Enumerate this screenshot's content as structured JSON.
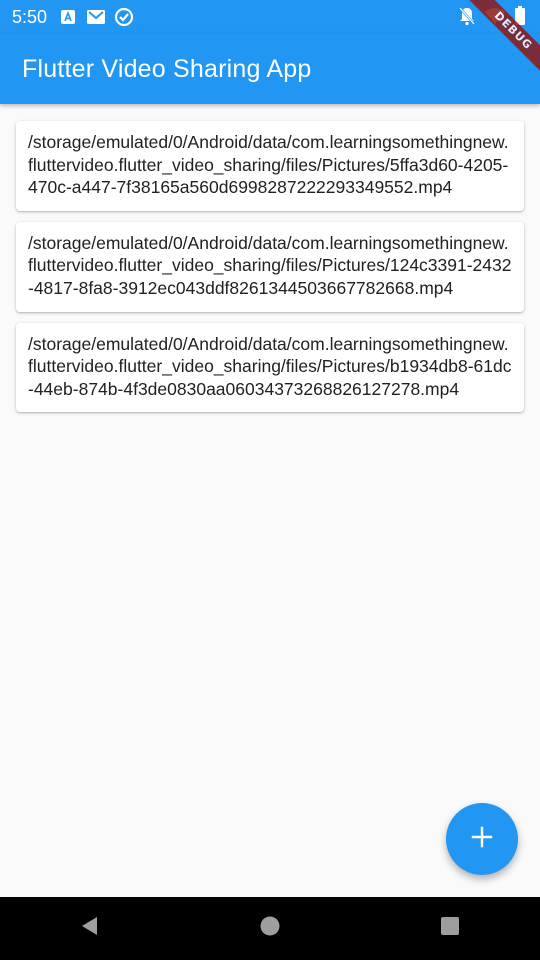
{
  "status_bar": {
    "time": "5:50",
    "left_icons": [
      "font-icon",
      "gmail-icon",
      "sync-icon"
    ],
    "right_icons": [
      "notifications-off-icon",
      "wifi-icon",
      "battery-icon"
    ]
  },
  "app_bar": {
    "title": "Flutter Video Sharing App",
    "color": "#2196f3"
  },
  "debug_banner": {
    "label": "DEBUG"
  },
  "videos": [
    {
      "path": "/storage/emulated/0/Android/data/com.learningsomethingnew.fluttervideo.flutter_video_sharing/files/Pictures/5ffa3d60-4205-470c-a447-7f38165a560d6998287222293349552.mp4"
    },
    {
      "path": "/storage/emulated/0/Android/data/com.learningsomethingnew.fluttervideo.flutter_video_sharing/files/Pictures/124c3391-2432-4817-8fa8-3912ec043ddf8261344503667782668.mp4"
    },
    {
      "path": "/storage/emulated/0/Android/data/com.learningsomethingnew.fluttervideo.flutter_video_sharing/files/Pictures/b1934db8-61dc-44eb-874b-4f3de0830aa06034373268826127278.mp4"
    }
  ],
  "fab": {
    "icon": "plus-icon",
    "color": "#2196f3"
  },
  "nav_bar": {
    "buttons": [
      "back-icon",
      "home-icon",
      "recents-icon"
    ]
  }
}
